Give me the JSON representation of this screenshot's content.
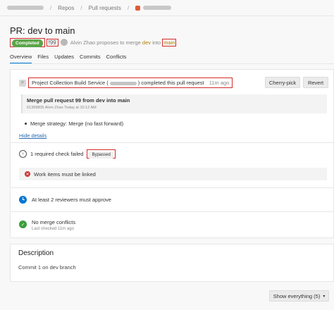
{
  "breadcrumb": {
    "repos": "Repos",
    "pull_requests": "Pull requests",
    "separator": "/"
  },
  "pr": {
    "title": "PR: dev to main",
    "status": "Completed",
    "number": "99",
    "author": "Alvin Zhao",
    "proposes_text": "proposes to merge",
    "source_branch": "dev",
    "into_text": "into",
    "target_branch": "main"
  },
  "tabs": [
    "Overview",
    "Files",
    "Updates",
    "Commits",
    "Conflicts"
  ],
  "completion": {
    "service_prefix": "Project Collection Build Service (",
    "service_suffix": ") completed this pull request",
    "time_ago": "11m ago",
    "cherry_pick_label": "Cherry-pick",
    "revert_label": "Revert"
  },
  "merge_commit": {
    "title": "Merge pull request 99 from dev into main",
    "commit_id": "61399805",
    "author": "Alvin Zhao",
    "date": "Today at 10:12 AM"
  },
  "merge_strategy": "Merge strategy: Merge (no fast forward)",
  "hide_details": "Hide details",
  "checks": {
    "label": "1 required check failed",
    "badge": "Bypassed"
  },
  "policy_failure": "Work items must be linked",
  "reviewers": "At least 2 reviewers must approve",
  "conflicts": {
    "title": "No merge conflicts",
    "subtitle": "Last checked 11m ago"
  },
  "description": {
    "heading": "Description",
    "body": "Commit 1 on dev branch"
  },
  "show_everything": "Show everything (5)",
  "colors": {
    "completed_badge": "#5aa54a",
    "highlight_box": "#d42a2a",
    "error": "#d13438",
    "info": "#0078d4",
    "success": "#3a9d3a",
    "branch": "#b07d00"
  }
}
